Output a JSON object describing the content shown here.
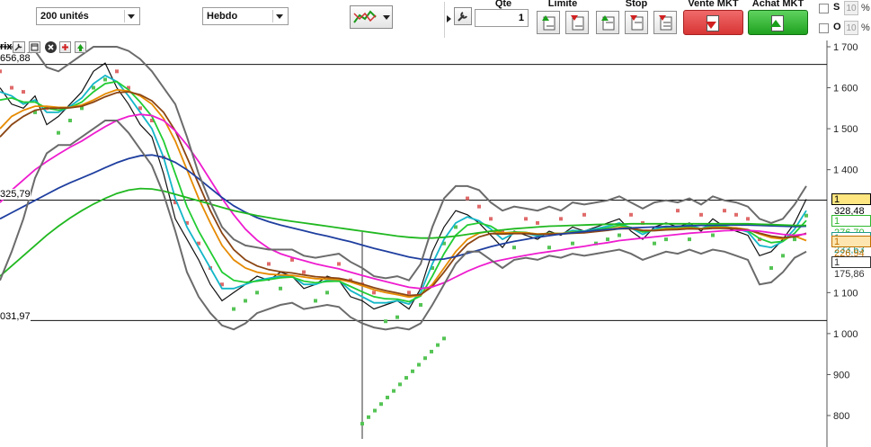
{
  "toolbar": {
    "units_select": "200 unités",
    "period_select": "Hebdo",
    "qte_label": "Qte",
    "qte_value": "1",
    "limite_label": "Limite",
    "stop_label": "Stop",
    "sell_label": "Vente MKT",
    "buy_label": "Achat MKT",
    "s_label": "S",
    "o_label": "O",
    "pct_value": "10",
    "pct_sign": "%"
  },
  "chart_panel": {
    "title_fragment": "rix",
    "level_top_label": "656,88",
    "level_mid_label": "325,79",
    "level_low_label": "031,97"
  },
  "chart_data": {
    "type": "line",
    "ylim": [
      760,
      1720
    ],
    "yticks": [
      {
        "value": 1700,
        "label": "1 700"
      },
      {
        "value": 1600,
        "label": "1 600"
      },
      {
        "value": 1500,
        "label": "1 500"
      },
      {
        "value": 1400,
        "label": "1 400"
      },
      {
        "value": 1100,
        "label": "1 100"
      },
      {
        "value": 1000,
        "label": "1 000"
      },
      {
        "value": 900,
        "label": "900"
      },
      {
        "value": 800,
        "label": "800"
      }
    ],
    "hlines": [
      1656.88,
      1325.79,
      1031.97
    ],
    "price_tags": [
      {
        "value": 1328.48,
        "label": "1 328,48",
        "bg": "#ffe680",
        "color": "#000000"
      },
      {
        "value": 1276.7,
        "label": "1 276,70",
        "bg": "#ffffff",
        "color": "#2fb82f"
      },
      {
        "value": 1233.63,
        "label": "1 233,63",
        "bg": "#ffffff",
        "color": "#1f9a8a"
      },
      {
        "value": 1226.94,
        "label": "1 226,94",
        "bg": "#ffe6b0",
        "color": "#c07000"
      },
      {
        "value": 1175.86,
        "label": "1 175,86",
        "bg": "#ffffff",
        "color": "#333333"
      }
    ],
    "n_points": 70,
    "series": [
      {
        "color": "#111111",
        "values": [
          1600,
          1560,
          1550,
          1580,
          1510,
          1530,
          1560,
          1590,
          1640,
          1660,
          1600,
          1560,
          1510,
          1480,
          1390,
          1280,
          1230,
          1180,
          1120,
          1080,
          1100,
          1120,
          1140,
          1130,
          1150,
          1140,
          1110,
          1120,
          1140,
          1130,
          1090,
          1080,
          1060,
          1070,
          1080,
          1060,
          1110,
          1200,
          1260,
          1300,
          1290,
          1270,
          1240,
          1210,
          1250,
          1240,
          1230,
          1250,
          1240,
          1260,
          1250,
          1260,
          1270,
          1280,
          1250,
          1230,
          1260,
          1270,
          1260,
          1270,
          1250,
          1280,
          1260,
          1250,
          1240,
          1190,
          1200,
          1230,
          1270,
          1328
        ]
      },
      {
        "color": "#13b6c8",
        "values": [
          1590,
          1580,
          1560,
          1570,
          1540,
          1540,
          1555,
          1575,
          1610,
          1630,
          1615,
          1580,
          1540,
          1500,
          1430,
          1330,
          1260,
          1210,
          1160,
          1110,
          1110,
          1120,
          1130,
          1135,
          1140,
          1140,
          1120,
          1120,
          1130,
          1130,
          1105,
          1090,
          1075,
          1075,
          1080,
          1072,
          1100,
          1170,
          1230,
          1270,
          1285,
          1275,
          1255,
          1230,
          1245,
          1245,
          1238,
          1245,
          1243,
          1252,
          1250,
          1256,
          1262,
          1270,
          1258,
          1242,
          1255,
          1262,
          1260,
          1265,
          1256,
          1268,
          1262,
          1256,
          1248,
          1215,
          1210,
          1225,
          1255,
          1300
        ]
      },
      {
        "color": "#22cc33",
        "values": [
          1570,
          1575,
          1565,
          1565,
          1550,
          1545,
          1552,
          1565,
          1590,
          1610,
          1615,
          1595,
          1565,
          1530,
          1470,
          1390,
          1310,
          1250,
          1200,
          1150,
          1130,
          1125,
          1128,
          1132,
          1136,
          1138,
          1128,
          1124,
          1127,
          1128,
          1115,
          1102,
          1090,
          1085,
          1084,
          1078,
          1092,
          1140,
          1195,
          1240,
          1265,
          1270,
          1262,
          1245,
          1248,
          1247,
          1242,
          1245,
          1244,
          1249,
          1249,
          1253,
          1258,
          1264,
          1259,
          1248,
          1252,
          1257,
          1257,
          1260,
          1256,
          1262,
          1260,
          1257,
          1251,
          1232,
          1222,
          1225,
          1245,
          1276
        ]
      },
      {
        "color": "#e68a00",
        "values": [
          1500,
          1530,
          1545,
          1555,
          1555,
          1552,
          1552,
          1558,
          1570,
          1585,
          1595,
          1592,
          1580,
          1560,
          1525,
          1470,
          1400,
          1330,
          1270,
          1215,
          1180,
          1160,
          1150,
          1145,
          1143,
          1142,
          1138,
          1134,
          1133,
          1132,
          1126,
          1117,
          1107,
          1100,
          1095,
          1089,
          1094,
          1120,
          1160,
          1200,
          1230,
          1245,
          1250,
          1246,
          1246,
          1246,
          1243,
          1244,
          1244,
          1247,
          1247,
          1250,
          1254,
          1259,
          1258,
          1252,
          1252,
          1255,
          1256,
          1258,
          1256,
          1259,
          1259,
          1258,
          1254,
          1243,
          1234,
          1231,
          1238,
          1227
        ]
      },
      {
        "color": "#8b4513",
        "values": [
          1480,
          1510,
          1530,
          1545,
          1550,
          1550,
          1551,
          1555,
          1565,
          1578,
          1588,
          1590,
          1583,
          1568,
          1540,
          1495,
          1430,
          1365,
          1300,
          1245,
          1205,
          1180,
          1165,
          1156,
          1151,
          1148,
          1143,
          1139,
          1137,
          1135,
          1129,
          1121,
          1112,
          1105,
          1099,
          1093,
          1095,
          1115,
          1150,
          1188,
          1218,
          1236,
          1244,
          1243,
          1244,
          1244,
          1242,
          1243,
          1243,
          1245,
          1246,
          1249,
          1252,
          1256,
          1256,
          1252,
          1251,
          1253,
          1254,
          1256,
          1255,
          1257,
          1257,
          1256,
          1253,
          1245,
          1238,
          1234,
          1236,
          1245
        ]
      },
      {
        "color": "#ee1ccf",
        "values": [
          1320,
          1350,
          1375,
          1400,
          1420,
          1438,
          1455,
          1470,
          1488,
          1505,
          1520,
          1530,
          1535,
          1532,
          1520,
          1495,
          1460,
          1420,
          1375,
          1330,
          1290,
          1255,
          1228,
          1208,
          1195,
          1186,
          1178,
          1170,
          1164,
          1158,
          1150,
          1142,
          1134,
          1127,
          1120,
          1113,
          1110,
          1114,
          1124,
          1138,
          1152,
          1164,
          1174,
          1180,
          1186,
          1191,
          1196,
          1200,
          1204,
          1209,
          1213,
          1218,
          1222,
          1227,
          1230,
          1233,
          1236,
          1239,
          1242,
          1245,
          1247,
          1249,
          1251,
          1252,
          1252,
          1250,
          1246,
          1242,
          1240,
          1243
        ]
      },
      {
        "color": "#1f3f9f",
        "values": [
          1280,
          1295,
          1310,
          1325,
          1340,
          1355,
          1368,
          1380,
          1392,
          1405,
          1417,
          1427,
          1434,
          1436,
          1430,
          1418,
          1400,
          1378,
          1355,
          1332,
          1312,
          1296,
          1283,
          1273,
          1265,
          1258,
          1251,
          1244,
          1238,
          1231,
          1224,
          1216,
          1208,
          1201,
          1194,
          1187,
          1182,
          1180,
          1182,
          1188,
          1196,
          1204,
          1212,
          1219,
          1225,
          1230,
          1235,
          1239,
          1243,
          1246,
          1249,
          1252,
          1254,
          1256,
          1258,
          1259,
          1260,
          1261,
          1262,
          1263,
          1264,
          1264,
          1265,
          1265,
          1265,
          1264,
          1263,
          1262,
          1261,
          1262
        ]
      },
      {
        "color": "#20b820",
        "values": [
          1140,
          1165,
          1190,
          1215,
          1240,
          1262,
          1282,
          1300,
          1316,
          1330,
          1342,
          1350,
          1354,
          1353,
          1348,
          1340,
          1332,
          1324,
          1316,
          1308,
          1300,
          1294,
          1288,
          1283,
          1278,
          1274,
          1270,
          1266,
          1262,
          1258,
          1254,
          1250,
          1246,
          1242,
          1238,
          1235,
          1233,
          1233,
          1235,
          1238,
          1242,
          1246,
          1250,
          1253,
          1256,
          1258,
          1260,
          1262,
          1263,
          1264,
          1265,
          1266,
          1267,
          1267,
          1268,
          1268,
          1268,
          1268,
          1268,
          1268,
          1268,
          1268,
          1268,
          1268,
          1268,
          1267,
          1266,
          1265,
          1264,
          1264
        ]
      },
      {
        "color": "#6b6b6b",
        "values": [
          1700,
          1700,
          1680,
          1690,
          1650,
          1640,
          1660,
          1680,
          1700,
          1700,
          1700,
          1690,
          1670,
          1640,
          1600,
          1560,
          1480,
          1390,
          1320,
          1260,
          1230,
          1215,
          1210,
          1205,
          1205,
          1205,
          1190,
          1185,
          1190,
          1195,
          1175,
          1160,
          1140,
          1135,
          1140,
          1130,
          1170,
          1260,
          1330,
          1360,
          1360,
          1350,
          1320,
          1300,
          1310,
          1305,
          1300,
          1310,
          1300,
          1320,
          1315,
          1320,
          1325,
          1335,
          1320,
          1305,
          1320,
          1325,
          1320,
          1330,
          1315,
          1335,
          1325,
          1320,
          1310,
          1280,
          1270,
          1280,
          1315,
          1360
        ]
      },
      {
        "color": "#6b6b6b",
        "values": [
          1130,
          1200,
          1280,
          1380,
          1440,
          1460,
          1460,
          1480,
          1500,
          1520,
          1520,
          1490,
          1450,
          1410,
          1340,
          1250,
          1150,
          1090,
          1050,
          1020,
          1010,
          1025,
          1050,
          1060,
          1070,
          1075,
          1060,
          1065,
          1070,
          1065,
          1040,
          1025,
          1015,
          1010,
          1015,
          1010,
          1025,
          1070,
          1120,
          1170,
          1200,
          1200,
          1180,
          1160,
          1180,
          1185,
          1180,
          1190,
          1185,
          1195,
          1190,
          1195,
          1200,
          1205,
          1195,
          1180,
          1190,
          1200,
          1195,
          1205,
          1195,
          1205,
          1200,
          1190,
          1180,
          1120,
          1125,
          1150,
          1185,
          1200
        ]
      }
    ]
  }
}
